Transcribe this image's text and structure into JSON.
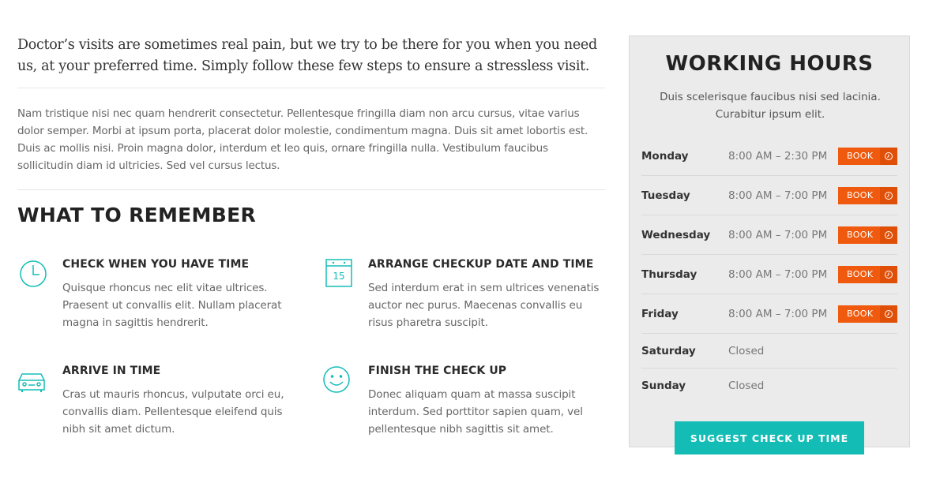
{
  "intro": "Doctor’s visits are sometimes real pain, but we try to be there for you when you need us, at your preferred time. Simply follow these few steps to ensure a stressless visit.",
  "body": "Nam tristique nisi nec quam hendrerit consectetur. Pellentesque fringilla diam non arcu cursus, vitae varius dolor semper. Morbi at ipsum porta, placerat dolor molestie, condimentum magna. Duis sit amet lobortis est. Duis ac mollis nisi. Proin magna dolor, interdum et leo quis, ornare fringilla nulla. Vestibulum faucibus sollicitudin diam id ultricies. Sed vel cursus lectus.",
  "section_title": "WHAT TO REMEMBER",
  "steps": [
    {
      "icon": "clock-icon",
      "title": "CHECK WHEN YOU HAVE TIME",
      "desc": "Quisque rhoncus nec elit vitae ultrices. Praesent ut convallis elit. Nullam placerat magna in sagittis hendrerit."
    },
    {
      "icon": "calendar-icon",
      "calendar_day": "15",
      "title": "ARRANGE CHECKUP DATE AND TIME",
      "desc": "Sed interdum erat in sem ultrices venenatis auctor nec purus. Maecenas convallis eu risus pharetra suscipit."
    },
    {
      "icon": "car-icon",
      "title": "ARRIVE IN TIME",
      "desc": "Cras ut mauris rhoncus, vulputate orci eu, convallis diam. Pellentesque eleifend quis nibh sit amet dictum."
    },
    {
      "icon": "smiley-icon",
      "title": "FINISH THE CHECK UP",
      "desc": "Donec aliquam quam at massa suscipit interdum. Sed porttitor sapien quam, vel pellentesque nibh sagittis sit amet."
    }
  ],
  "hours": {
    "title": "WORKING HOURS",
    "subtitle": "Duis scelerisque faucibus nisi sed lacinia. Curabitur ipsum elit.",
    "book_label": "BOOK",
    "rows": [
      {
        "day": "Monday",
        "time": "8:00 AM – 2:30 PM"
      },
      {
        "day": "Tuesday",
        "time": "8:00 AM – 7:00 PM"
      },
      {
        "day": "Wednesday",
        "time": "8:00 AM – 7:00 PM"
      },
      {
        "day": "Thursday",
        "time": "8:00 AM – 7:00 PM"
      },
      {
        "day": "Friday",
        "time": "8:00 AM – 7:00 PM"
      },
      {
        "day": "Saturday",
        "time": "Closed"
      },
      {
        "day": "Sunday",
        "time": "Closed"
      }
    ],
    "suggest_label": "SUGGEST CHECK UP TIME"
  },
  "colors": {
    "accent": "#13bdb6",
    "book": "#f05a0e",
    "panel": "#ebebeb"
  }
}
